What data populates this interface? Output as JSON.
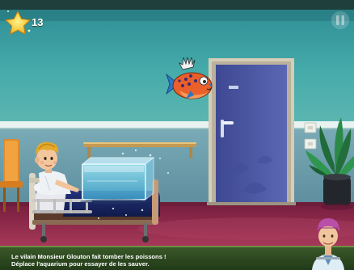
{
  "hud": {
    "score": "13",
    "score_icon": "star-icon",
    "pause_icon": "pause-icon"
  },
  "dialog": {
    "line1": "Le vilain Monsieur Glouton fait tomber les poissons !",
    "line2": "Déplace l'aquarium pour essayer de les sauver.",
    "speaker": "doctor-avatar"
  },
  "colors": {
    "wall": "#3fa7a8",
    "wall_lower": "#6aa1ad",
    "floor": "#8c2a4a",
    "door": "#4f5aa3",
    "door_frame": "#c8c0ad",
    "dialog_bg": "#2f4a22",
    "fish_body": "#e9602a",
    "aquarium_water": "#4fb7d8"
  }
}
